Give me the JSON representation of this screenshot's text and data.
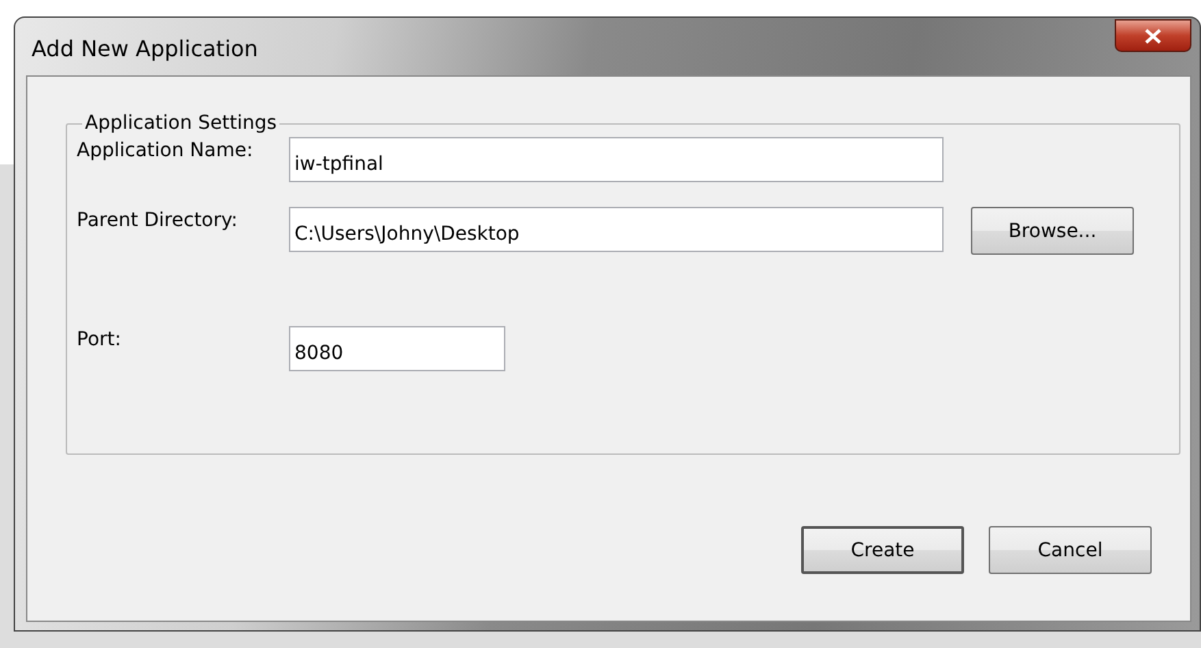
{
  "window": {
    "title": "Add New Application"
  },
  "group": {
    "title": "Application Settings",
    "fields": [
      {
        "label": "Application Name:",
        "value": "iw-tpfinal",
        "kind": "wide"
      },
      {
        "label": "Parent Directory:",
        "value": "C:\\Users\\Johny\\Desktop",
        "kind": "browse",
        "button": "Browse..."
      },
      {
        "label": "Port:",
        "value": "8080",
        "kind": "short"
      }
    ]
  },
  "buttons": [
    {
      "label": "Create",
      "default": true
    },
    {
      "label": "Cancel",
      "default": false
    }
  ]
}
